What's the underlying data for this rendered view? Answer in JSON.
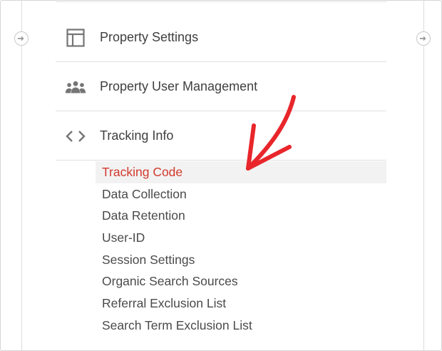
{
  "icons": {
    "collapse_left": "arrow-right-circle-icon",
    "collapse_right": "arrow-right-circle-icon",
    "property_settings": "layout-icon",
    "user_management": "people-icon",
    "tracking_info": "code-brackets-icon",
    "annotation": "red-arrow-icon"
  },
  "colors": {
    "active_text": "#d23a2e",
    "active_bg": "#f2f2f2",
    "annotation_arrow": "#e8262b",
    "icon_gray": "#757575"
  },
  "menu": {
    "items": [
      {
        "label": "Property Settings"
      },
      {
        "label": "Property User Management"
      },
      {
        "label": "Tracking Info"
      }
    ]
  },
  "tracking_info": {
    "subitems": [
      {
        "label": "Tracking Code",
        "active": true
      },
      {
        "label": "Data Collection"
      },
      {
        "label": "Data Retention"
      },
      {
        "label": "User-ID"
      },
      {
        "label": "Session Settings"
      },
      {
        "label": "Organic Search Sources"
      },
      {
        "label": "Referral Exclusion List"
      },
      {
        "label": "Search Term Exclusion List"
      }
    ]
  }
}
